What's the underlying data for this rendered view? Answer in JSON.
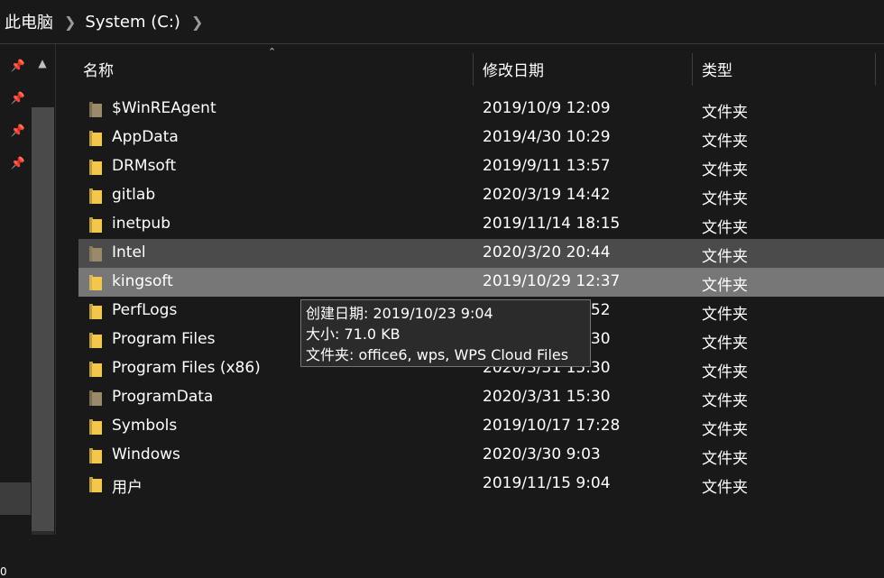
{
  "breadcrumb": [
    "此电脑",
    "System (C:)"
  ],
  "columns": {
    "name": "名称",
    "date": "修改日期",
    "type": "类型"
  },
  "files": [
    {
      "name": "$WinREAgent",
      "date": "2019/10/9 12:09",
      "type": "文件夹",
      "icon": "folder-icon-dim"
    },
    {
      "name": "AppData",
      "date": "2019/4/30 10:29",
      "type": "文件夹",
      "icon": "folder-icon"
    },
    {
      "name": "DRMsoft",
      "date": "2019/9/11 13:57",
      "type": "文件夹",
      "icon": "folder-icon"
    },
    {
      "name": "gitlab",
      "date": "2020/3/19 14:42",
      "type": "文件夹",
      "icon": "folder-icon"
    },
    {
      "name": "inetpub",
      "date": "2019/11/14 18:15",
      "type": "文件夹",
      "icon": "folder-icon"
    },
    {
      "name": "Intel",
      "date": "2020/3/20 20:44",
      "type": "文件夹",
      "icon": "folder-icon-dim"
    },
    {
      "name": "kingsoft",
      "date": "2019/10/29 12:37",
      "type": "文件夹",
      "icon": "folder-icon"
    },
    {
      "name": "PerfLogs",
      "date": "2019/3/19 12:52",
      "type": "文件夹",
      "icon": "folder-icon"
    },
    {
      "name": "Program Files",
      "date": "2020/3/31 15:30",
      "type": "文件夹",
      "icon": "folder-icon"
    },
    {
      "name": "Program Files (x86)",
      "date": "2020/3/31 15:30",
      "type": "文件夹",
      "icon": "folder-icon"
    },
    {
      "name": "ProgramData",
      "date": "2020/3/31 15:30",
      "type": "文件夹",
      "icon": "folder-icon-dim"
    },
    {
      "name": "Symbols",
      "date": "2019/10/17 17:28",
      "type": "文件夹",
      "icon": "folder-icon"
    },
    {
      "name": "Windows",
      "date": "2020/3/30 9:03",
      "type": "文件夹",
      "icon": "folder-icon"
    },
    {
      "name": "用户",
      "date": "2019/11/15 9:04",
      "type": "文件夹",
      "icon": "folder-icon"
    }
  ],
  "tooltip": {
    "created": "创建日期: 2019/10/23 9:04",
    "size": "大小: 71.0 KB",
    "folder": "文件夹: office6, wps, WPS Cloud Files"
  },
  "nav": {
    "bottom_text": "0"
  },
  "colors": {
    "background": "#191919",
    "hover_row": "#4b4b4b",
    "selected_row": "#777777",
    "folder_yellow": "#f3c84a",
    "folder_dim": "#9a8a6a"
  }
}
